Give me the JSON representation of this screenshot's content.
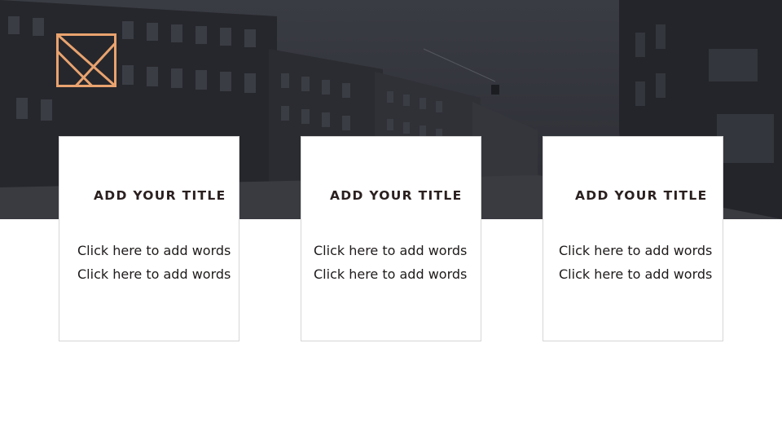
{
  "slide": {
    "hero_image": "city-street-photo",
    "accent_color": "#e9a36f",
    "card_border_color": "#d6d6d6",
    "logo_icon": "square-diagonal-logo-icon"
  },
  "cards": [
    {
      "title": "ADD YOUR TITLE",
      "lines": [
        "Click here to add words",
        "Click here to add words"
      ]
    },
    {
      "title": "ADD YOUR TITLE",
      "lines": [
        "Click here to add words",
        "Click here to add words"
      ]
    },
    {
      "title": "ADD YOUR TITLE",
      "lines": [
        "Click here to add words",
        "Click here to add words"
      ]
    }
  ]
}
